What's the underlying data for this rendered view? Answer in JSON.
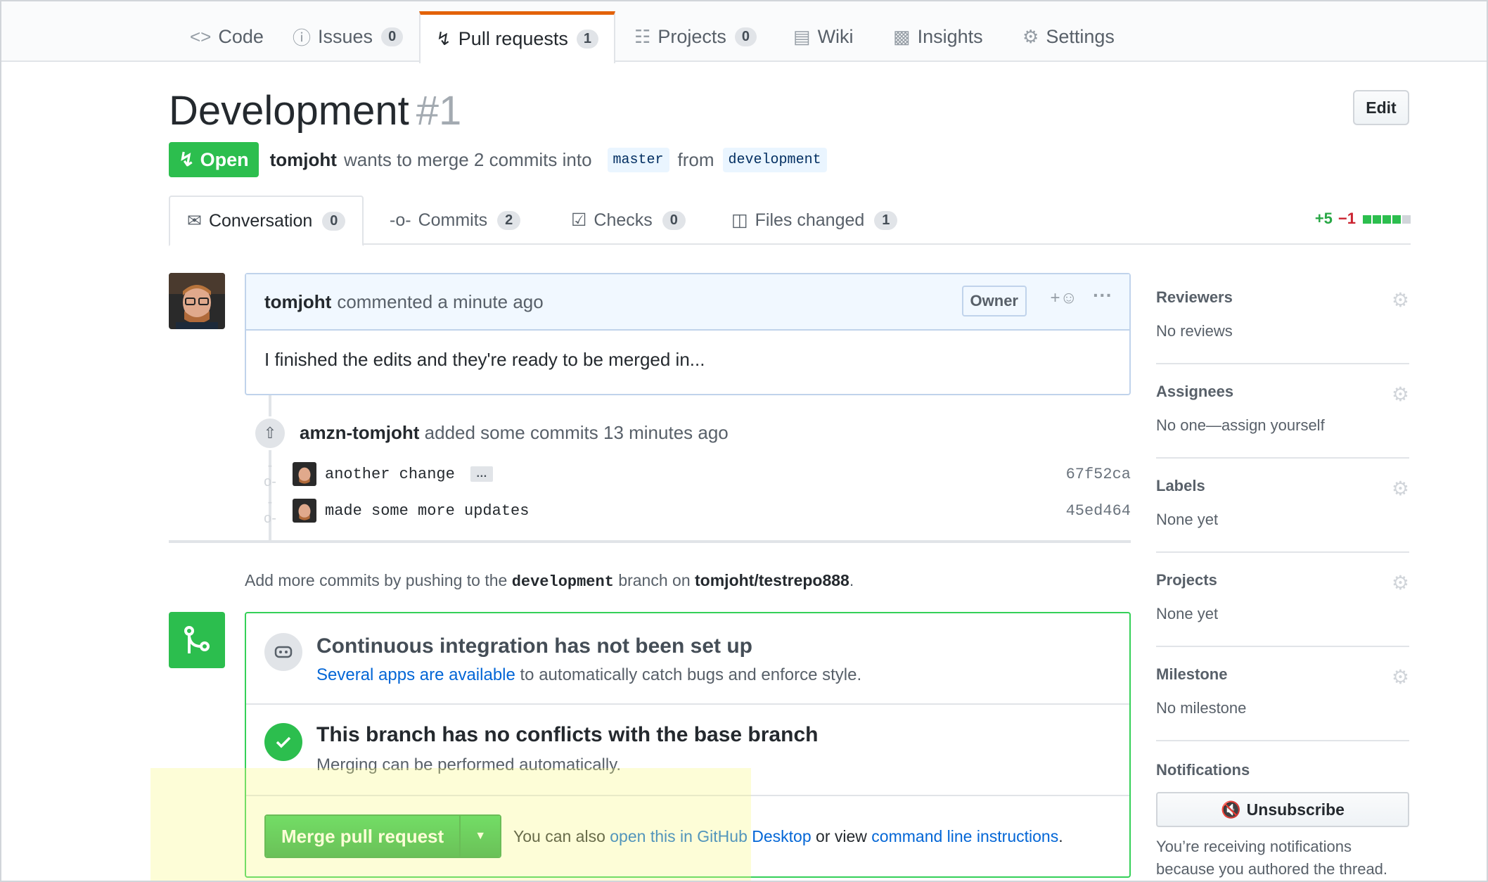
{
  "repo_nav": {
    "tabs": [
      {
        "label": "Code",
        "icon": "code-icon",
        "count": null
      },
      {
        "label": "Issues",
        "icon": "issue-icon",
        "count": "0"
      },
      {
        "label": "Pull requests",
        "icon": "pull-request-icon",
        "count": "1"
      },
      {
        "label": "Projects",
        "icon": "project-icon",
        "count": "0"
      },
      {
        "label": "Wiki",
        "icon": "book-icon",
        "count": null
      },
      {
        "label": "Insights",
        "icon": "graph-icon",
        "count": null
      },
      {
        "label": "Settings",
        "icon": "gear-icon",
        "count": null
      }
    ],
    "selected": "Pull requests"
  },
  "pr": {
    "title": "Development",
    "number": "#1",
    "edit_label": "Edit",
    "state": "Open",
    "author": "tomjoht",
    "merge_text": "wants to merge 2 commits into",
    "base_branch": "master",
    "from_text": "from",
    "head_branch": "development"
  },
  "pr_tabs": [
    {
      "label": "Conversation",
      "count": "0",
      "icon": "comment-discussion-icon"
    },
    {
      "label": "Commits",
      "count": "2",
      "icon": "commit-icon"
    },
    {
      "label": "Checks",
      "count": "0",
      "icon": "checklist-icon"
    },
    {
      "label": "Files changed",
      "count": "1",
      "icon": "diff-icon"
    }
  ],
  "diffstat": {
    "additions": "+5",
    "deletions": "−1",
    "blocks": [
      "#2cbe4e",
      "#2cbe4e",
      "#2cbe4e",
      "#2cbe4e",
      "#d1d5da"
    ]
  },
  "comment": {
    "author": "tomjoht",
    "meta": "commented a minute ago",
    "badge": "Owner",
    "react_icon": "+☺",
    "more_icon": "···",
    "body": "I finished the edits and they're ready to be merged in..."
  },
  "commits_event": {
    "author": "amzn-tomjoht",
    "text": "added some commits 13 minutes ago",
    "commits": [
      {
        "message": "another change",
        "sha": "67f52ca",
        "has_more": true,
        "more_label": "…"
      },
      {
        "message": "made some more updates",
        "sha": "45ed464",
        "has_more": false
      }
    ]
  },
  "push_hint": {
    "prefix": "Add more commits by pushing to the",
    "branch": "development",
    "middle": "branch on",
    "repo": "tomjoht/testrepo888",
    "suffix": "."
  },
  "merge_box": {
    "ci_title": "Continuous integration has not been set up",
    "ci_link": "Several apps are available",
    "ci_rest": "to automatically catch bugs and enforce style.",
    "conflict_title": "This branch has no conflicts with the base branch",
    "conflict_sub": "Merging can be performed automatically.",
    "merge_button": "Merge pull request",
    "foot_prefix": "You can also",
    "foot_link1": "open this in GitHub Desktop",
    "foot_mid": "or view",
    "foot_link2": "command line instructions",
    "foot_suffix": "."
  },
  "sidebar": {
    "items": [
      {
        "heading": "Reviewers",
        "value": "No reviews"
      },
      {
        "heading": "Assignees",
        "value": "No one—assign yourself"
      },
      {
        "heading": "Labels",
        "value": "None yet"
      },
      {
        "heading": "Projects",
        "value": "None yet"
      },
      {
        "heading": "Milestone",
        "value": "No milestone"
      }
    ],
    "notifications": {
      "heading": "Notifications",
      "button": "Unsubscribe",
      "text": "You’re receiving notifications because you authored the thread."
    }
  },
  "colors": {
    "accent_orange": "#e36209",
    "open_green": "#2cbe4e",
    "link_blue": "#0366d6"
  }
}
